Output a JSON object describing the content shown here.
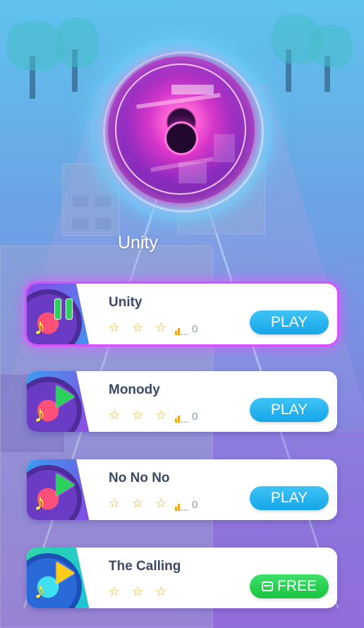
{
  "now_playing": {
    "title": "Unity"
  },
  "songs": [
    {
      "title": "Unity",
      "stars": "☆ ☆ ☆",
      "rank_count": "0",
      "button_label": "PLAY",
      "button_type": "play",
      "state": "playing",
      "accent": "#d651ff"
    },
    {
      "title": "Monody",
      "stars": "☆ ☆ ☆",
      "rank_count": "0",
      "button_label": "PLAY",
      "button_type": "play",
      "state": "paused"
    },
    {
      "title": "No No No",
      "stars": "☆ ☆ ☆",
      "rank_count": "0",
      "button_label": "PLAY",
      "button_type": "play",
      "state": "paused"
    },
    {
      "title": "The Calling",
      "stars": "☆ ☆ ☆",
      "rank_count": "",
      "button_label": "FREE",
      "button_type": "free",
      "state": "locked"
    }
  ],
  "colors": {
    "play_button": "#15a6e9",
    "free_button": "#18c43f",
    "active_glow": "#d651ff",
    "star": "#e9b21b",
    "note": "#ffe84a"
  },
  "icons": {
    "play": "play-icon",
    "pause": "pause-icon",
    "note": "music-note-icon",
    "ad": "video-ad-icon",
    "rank": "rank-bars-icon",
    "star": "star-icon"
  }
}
